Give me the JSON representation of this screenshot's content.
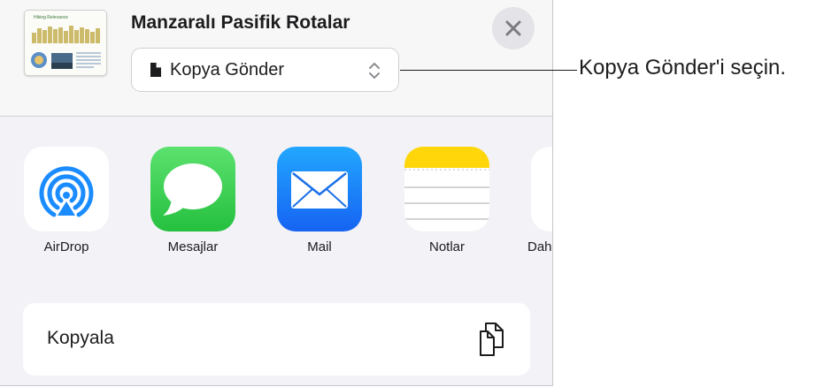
{
  "header": {
    "document_title": "Manzaralı Pasifik Rotalar",
    "thumbnail_title": "Hiking Relevance",
    "close_icon": "xmark-icon",
    "format_selector": {
      "label": "Kopya Gönder",
      "icon": "doc-icon",
      "chevron_icon": "chevron-up-down-icon"
    }
  },
  "share_apps": [
    {
      "label": "AirDrop",
      "icon": "airdrop-icon"
    },
    {
      "label": "Mesajlar",
      "icon": "messages-icon"
    },
    {
      "label": "Mail",
      "icon": "mail-icon"
    },
    {
      "label": "Notlar",
      "icon": "notes-icon"
    },
    {
      "label": "Dah",
      "icon": "more-icon"
    }
  ],
  "actions": [
    {
      "label": "Kopyala",
      "icon": "copy-icon"
    }
  ],
  "callout": {
    "text": "Kopya Gönder'i seçin."
  },
  "colors": {
    "airdrop_blue": "#1a8cff",
    "messages_green": "#34c759",
    "mail_blue": "#1f8efa",
    "notes_yellow": "#ffd60a",
    "sheet_background": "#f2f2f7"
  }
}
